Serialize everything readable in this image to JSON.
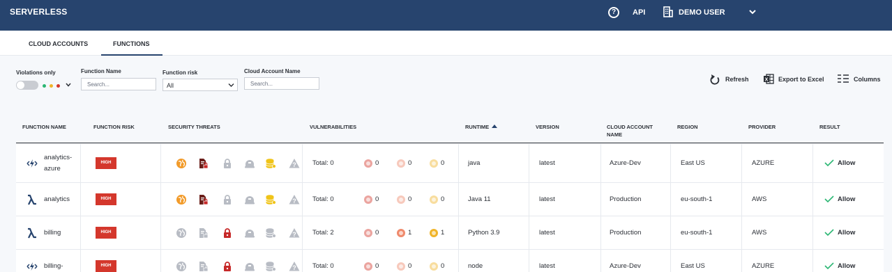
{
  "header": {
    "brand": "SERVERLESS",
    "help_icon": "question-circle-icon",
    "api_label": "API",
    "user_icon": "building-icon",
    "user_name": "DEMO USER",
    "user_menu_icon": "chevron-down-icon"
  },
  "tabs": [
    {
      "label": "CLOUD ACCOUNTS",
      "active": false
    },
    {
      "label": "FUNCTIONS",
      "active": true
    }
  ],
  "filters": {
    "violations_label": "Violations only",
    "violations_on": false,
    "severity_colors": [
      "#2bb673",
      "#f0b429",
      "#d4372c"
    ],
    "function_name_label": "Function Name",
    "function_name_placeholder": "Search...",
    "function_risk_label": "Function risk",
    "function_risk_value": "All",
    "cloud_account_label": "Cloud Account Name",
    "cloud_account_placeholder": "Search..."
  },
  "actions": {
    "refresh": "Refresh",
    "export": "Export to Excel",
    "columns": "Columns"
  },
  "columns": {
    "function_name": "FUNCTION NAME",
    "function_risk": "FUNCTION RISK",
    "security_threats": "SECURITY THREATS",
    "vulnerabilities": "VULNERABILITIES",
    "runtime": "RUNTIME",
    "runtime_sort": "ascending",
    "version": "VERSION",
    "cloud_account_1": "CLOUD ACCOUNT",
    "cloud_account_2": "NAME",
    "region": "REGION",
    "provider": "PROVIDER",
    "result": "RESULT"
  },
  "colors": {
    "header_bg": "#27446e",
    "risk_high": "#d4372c",
    "threat_active_orange": "#f29b2a",
    "threat_active_yellow": "#f0c419",
    "threat_active_red": "#c62828",
    "threat_inactive": "#b8bcc4",
    "allow_check": "#2bb673",
    "vuln_critical": "#d4372c",
    "vuln_high": "#ef8a6c",
    "vuln_medium": "#f0b429"
  },
  "rows": [
    {
      "name_line1": "analytics-",
      "name_line2": "azure",
      "icon": "azure-function-icon",
      "risk": "HIGH",
      "threats": {
        "globe": "orange",
        "doc_lock": "red",
        "lock": "inactive",
        "helmet": "inactive",
        "db": "yellow",
        "warn": "inactive"
      },
      "vuln_total": "Total: 0",
      "vuln_critical": "0",
      "vuln_high": "0",
      "vuln_medium": "0",
      "vuln_active": false,
      "runtime": "java",
      "version": "latest",
      "account": "Azure-Dev",
      "region": "East US",
      "provider": "AZURE",
      "result": "Allow"
    },
    {
      "name_line1": "analytics",
      "name_line2": "",
      "icon": "lambda-icon",
      "risk": "HIGH",
      "threats": {
        "globe": "orange",
        "doc_lock": "red",
        "lock": "inactive",
        "helmet": "inactive",
        "db": "yellow",
        "warn": "inactive"
      },
      "vuln_total": "Total: 0",
      "vuln_critical": "0",
      "vuln_high": "0",
      "vuln_medium": "0",
      "vuln_active": false,
      "runtime": "Java 11",
      "version": "latest",
      "account": "Production",
      "region": "eu-south-1",
      "provider": "AWS",
      "result": "Allow"
    },
    {
      "name_line1": "billing",
      "name_line2": "",
      "icon": "lambda-icon",
      "risk": "HIGH",
      "threats": {
        "globe": "inactive",
        "doc_lock": "inactive",
        "lock": "red",
        "helmet": "inactive",
        "db": "inactive",
        "warn": "inactive"
      },
      "vuln_total": "Total: 2",
      "vuln_critical": "0",
      "vuln_high": "1",
      "vuln_medium": "1",
      "vuln_active": true,
      "runtime": "Python 3.9",
      "version": "latest",
      "account": "Production",
      "region": "eu-south-1",
      "provider": "AWS",
      "result": "Allow"
    },
    {
      "name_line1": "billing-",
      "name_line2": "",
      "icon": "azure-function-icon",
      "risk": "HIGH",
      "threats": {
        "globe": "inactive",
        "doc_lock": "inactive",
        "lock": "red",
        "helmet": "inactive",
        "db": "inactive",
        "warn": "inactive"
      },
      "vuln_total": "Total: 0",
      "vuln_critical": "0",
      "vuln_high": "0",
      "vuln_medium": "0",
      "vuln_active": false,
      "runtime": "node",
      "version": "latest",
      "account": "Azure-Dev",
      "region": "East US",
      "provider": "AZURE",
      "result": "Allow"
    }
  ]
}
